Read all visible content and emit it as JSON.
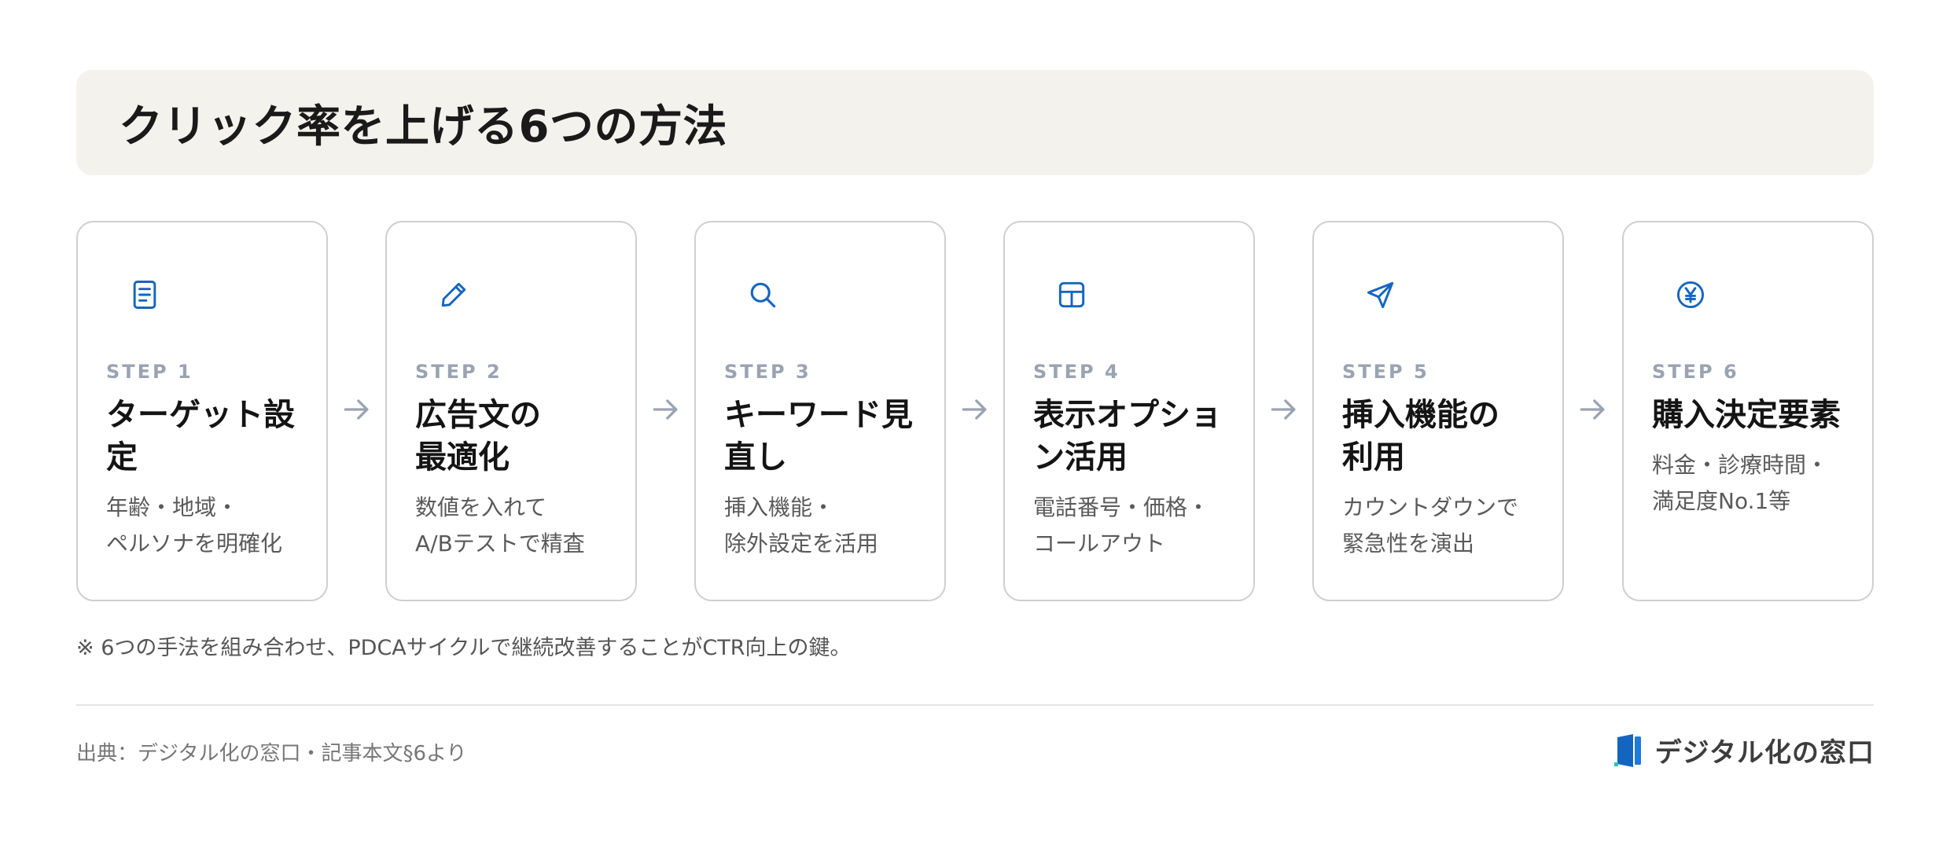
{
  "title": "クリック率を上げる6つの方法",
  "accent_color": "#1565c0",
  "steps": [
    {
      "label": "STEP 1",
      "title": "ターゲット設定",
      "desc": "年齢・地域・\nペルソナを明確化",
      "icon": "document-icon"
    },
    {
      "label": "STEP 2",
      "title": "広告文の\n最適化",
      "desc": "数値を入れて\nA/Bテストで精査",
      "icon": "pencil-icon"
    },
    {
      "label": "STEP 3",
      "title": "キーワード見直し",
      "desc": "挿入機能・\n除外設定を活用",
      "icon": "search-icon"
    },
    {
      "label": "STEP 4",
      "title": "表示オプション活用",
      "desc": "電話番号・価格・\nコールアウト",
      "icon": "grid-icon"
    },
    {
      "label": "STEP 5",
      "title": "挿入機能の\n利用",
      "desc": "カウントダウンで\n緊急性を演出",
      "icon": "send-icon"
    },
    {
      "label": "STEP 6",
      "title": "購入決定要素",
      "desc": "料金・診療時間・\n満足度No.1等",
      "icon": "yen-icon"
    }
  ],
  "note": "※ 6つの手法を組み合わせ、PDCAサイクルで継続改善することがCTR向上の鍵。",
  "source": "出典：デジタル化の窓口・記事本文§6より",
  "brand": "デジタル化の窓口"
}
